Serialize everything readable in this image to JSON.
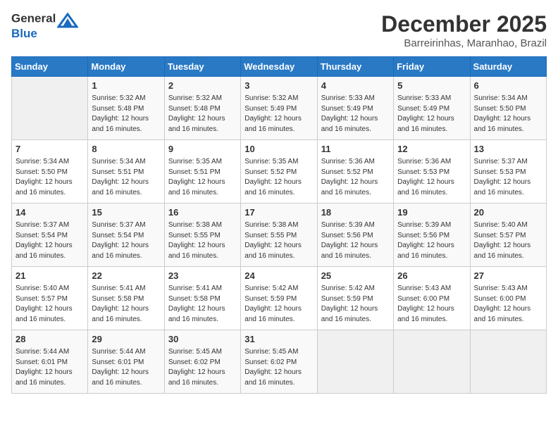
{
  "header": {
    "logo_line1": "General",
    "logo_line2": "Blue",
    "month": "December 2025",
    "location": "Barreirinhas, Maranhao, Brazil"
  },
  "days_of_week": [
    "Sunday",
    "Monday",
    "Tuesday",
    "Wednesday",
    "Thursday",
    "Friday",
    "Saturday"
  ],
  "weeks": [
    [
      {
        "day": "",
        "sunrise": "",
        "sunset": "",
        "daylight": ""
      },
      {
        "day": "1",
        "sunrise": "5:32 AM",
        "sunset": "5:48 PM",
        "daylight": "12 hours and 16 minutes."
      },
      {
        "day": "2",
        "sunrise": "5:32 AM",
        "sunset": "5:48 PM",
        "daylight": "12 hours and 16 minutes."
      },
      {
        "day": "3",
        "sunrise": "5:32 AM",
        "sunset": "5:49 PM",
        "daylight": "12 hours and 16 minutes."
      },
      {
        "day": "4",
        "sunrise": "5:33 AM",
        "sunset": "5:49 PM",
        "daylight": "12 hours and 16 minutes."
      },
      {
        "day": "5",
        "sunrise": "5:33 AM",
        "sunset": "5:49 PM",
        "daylight": "12 hours and 16 minutes."
      },
      {
        "day": "6",
        "sunrise": "5:34 AM",
        "sunset": "5:50 PM",
        "daylight": "12 hours and 16 minutes."
      }
    ],
    [
      {
        "day": "7",
        "sunrise": "5:34 AM",
        "sunset": "5:50 PM",
        "daylight": "12 hours and 16 minutes."
      },
      {
        "day": "8",
        "sunrise": "5:34 AM",
        "sunset": "5:51 PM",
        "daylight": "12 hours and 16 minutes."
      },
      {
        "day": "9",
        "sunrise": "5:35 AM",
        "sunset": "5:51 PM",
        "daylight": "12 hours and 16 minutes."
      },
      {
        "day": "10",
        "sunrise": "5:35 AM",
        "sunset": "5:52 PM",
        "daylight": "12 hours and 16 minutes."
      },
      {
        "day": "11",
        "sunrise": "5:36 AM",
        "sunset": "5:52 PM",
        "daylight": "12 hours and 16 minutes."
      },
      {
        "day": "12",
        "sunrise": "5:36 AM",
        "sunset": "5:53 PM",
        "daylight": "12 hours and 16 minutes."
      },
      {
        "day": "13",
        "sunrise": "5:37 AM",
        "sunset": "5:53 PM",
        "daylight": "12 hours and 16 minutes."
      }
    ],
    [
      {
        "day": "14",
        "sunrise": "5:37 AM",
        "sunset": "5:54 PM",
        "daylight": "12 hours and 16 minutes."
      },
      {
        "day": "15",
        "sunrise": "5:37 AM",
        "sunset": "5:54 PM",
        "daylight": "12 hours and 16 minutes."
      },
      {
        "day": "16",
        "sunrise": "5:38 AM",
        "sunset": "5:55 PM",
        "daylight": "12 hours and 16 minutes."
      },
      {
        "day": "17",
        "sunrise": "5:38 AM",
        "sunset": "5:55 PM",
        "daylight": "12 hours and 16 minutes."
      },
      {
        "day": "18",
        "sunrise": "5:39 AM",
        "sunset": "5:56 PM",
        "daylight": "12 hours and 16 minutes."
      },
      {
        "day": "19",
        "sunrise": "5:39 AM",
        "sunset": "5:56 PM",
        "daylight": "12 hours and 16 minutes."
      },
      {
        "day": "20",
        "sunrise": "5:40 AM",
        "sunset": "5:57 PM",
        "daylight": "12 hours and 16 minutes."
      }
    ],
    [
      {
        "day": "21",
        "sunrise": "5:40 AM",
        "sunset": "5:57 PM",
        "daylight": "12 hours and 16 minutes."
      },
      {
        "day": "22",
        "sunrise": "5:41 AM",
        "sunset": "5:58 PM",
        "daylight": "12 hours and 16 minutes."
      },
      {
        "day": "23",
        "sunrise": "5:41 AM",
        "sunset": "5:58 PM",
        "daylight": "12 hours and 16 minutes."
      },
      {
        "day": "24",
        "sunrise": "5:42 AM",
        "sunset": "5:59 PM",
        "daylight": "12 hours and 16 minutes."
      },
      {
        "day": "25",
        "sunrise": "5:42 AM",
        "sunset": "5:59 PM",
        "daylight": "12 hours and 16 minutes."
      },
      {
        "day": "26",
        "sunrise": "5:43 AM",
        "sunset": "6:00 PM",
        "daylight": "12 hours and 16 minutes."
      },
      {
        "day": "27",
        "sunrise": "5:43 AM",
        "sunset": "6:00 PM",
        "daylight": "12 hours and 16 minutes."
      }
    ],
    [
      {
        "day": "28",
        "sunrise": "5:44 AM",
        "sunset": "6:01 PM",
        "daylight": "12 hours and 16 minutes."
      },
      {
        "day": "29",
        "sunrise": "5:44 AM",
        "sunset": "6:01 PM",
        "daylight": "12 hours and 16 minutes."
      },
      {
        "day": "30",
        "sunrise": "5:45 AM",
        "sunset": "6:02 PM",
        "daylight": "12 hours and 16 minutes."
      },
      {
        "day": "31",
        "sunrise": "5:45 AM",
        "sunset": "6:02 PM",
        "daylight": "12 hours and 16 minutes."
      },
      {
        "day": "",
        "sunrise": "",
        "sunset": "",
        "daylight": ""
      },
      {
        "day": "",
        "sunrise": "",
        "sunset": "",
        "daylight": ""
      },
      {
        "day": "",
        "sunrise": "",
        "sunset": "",
        "daylight": ""
      }
    ]
  ]
}
